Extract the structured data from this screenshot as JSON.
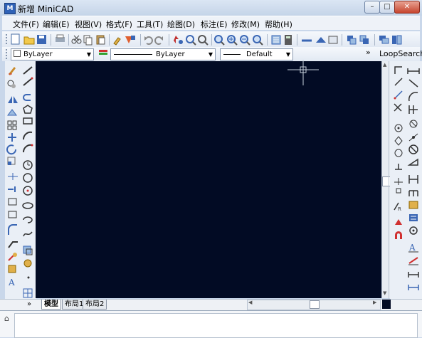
{
  "window": {
    "title": "新增 MiniCAD",
    "app_icon": "M",
    "minimize": "–",
    "maximize": "□",
    "close": "✕"
  },
  "menu": [
    "文件(F)",
    "编辑(E)",
    "视图(V)",
    "格式(F)",
    "工具(T)",
    "绘图(D)",
    "标注(E)",
    "修改(M)",
    "帮助(H)"
  ],
  "properties": {
    "layer": "ByLayer",
    "color": "ByLayer",
    "linetype": "Default",
    "overflow": "»",
    "loop_search": "LoopSearch"
  },
  "tabs": [
    {
      "label": "模型",
      "active": true
    },
    {
      "label": "布局1",
      "active": false
    },
    {
      "label": "布局2",
      "active": false
    }
  ],
  "colors": {
    "canvas": "#020b24",
    "accent": "#2f62b7",
    "crosshair": "#c7d0dc"
  },
  "command_icon": "⌂",
  "expand_glyph": "»",
  "left_toolbar_icons": [
    "paint-brush-icon",
    "gear-icon",
    "mirror-icon",
    "stamp-icon",
    "array-icon",
    "move-icon",
    "rotate-icon",
    "scale-icon",
    "trim-icon",
    "extend-icon",
    "rectangle-icon",
    "square-icon",
    "fillet-icon",
    "chamfer-icon",
    "explode-icon",
    "edit-icon",
    "text-style-icon",
    "line-icon",
    "polyline-icon",
    "arc-icon",
    "pentagon-icon",
    "rectangle-icon",
    "arc-icon",
    "spline-icon",
    "clock-icon",
    "circle-icon",
    "circle-dot-icon",
    "ellipse-icon",
    "ellipse-arc-icon",
    "wave-icon",
    "block-icon",
    "insert-icon",
    "point-icon",
    "hatch-icon"
  ]
}
